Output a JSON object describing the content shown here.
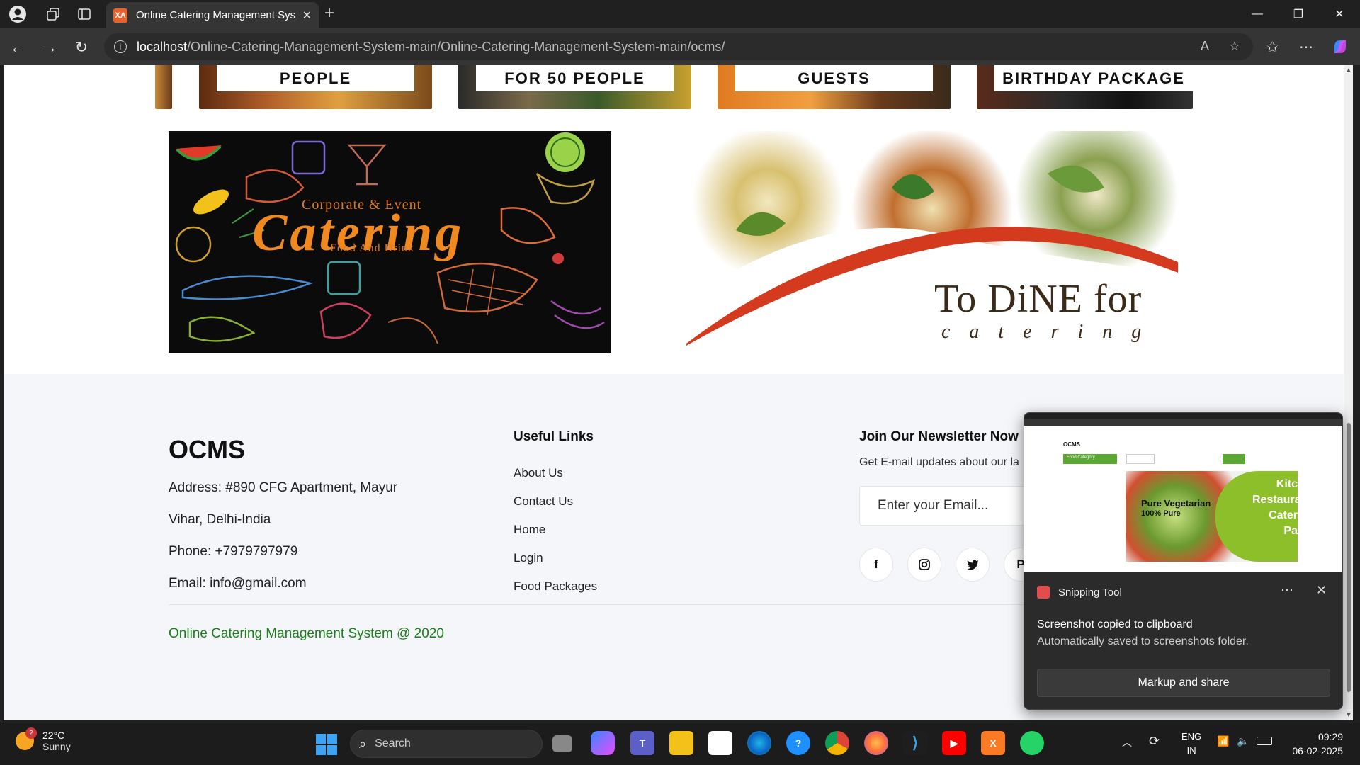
{
  "browser": {
    "tab_title": "Online Catering Management Sys",
    "tab_favicon": "XA",
    "url_host": "localhost",
    "url_path": "/Online-Catering-Management-System-main/Online-Catering-Management-System-main/ocms/"
  },
  "packages": [
    {
      "label": "PEOPLE"
    },
    {
      "label": "FOR 50 PEOPLE"
    },
    {
      "label": "GUESTS"
    },
    {
      "label": "BIRTHDAY PACKAGE"
    }
  ],
  "banner1": {
    "line1": "Corporate & Event",
    "line2": "Catering",
    "line3": "Food And Drink"
  },
  "banner2": {
    "line1": "To DiNE for",
    "line2": "c a t e r i n g"
  },
  "footer": {
    "brand": "OCMS",
    "address_line1": "Address: #890 CFG Apartment, Mayur",
    "address_line2": "Vihar, Delhi-India",
    "phone": "Phone: +7979797979",
    "email": "Email: info@gmail.com",
    "links_heading": "Useful Links",
    "links": [
      "About Us",
      "Contact Us",
      "Home",
      "Login",
      "Food Packages"
    ],
    "newsletter_heading": "Join Our Newsletter Now",
    "newsletter_desc": "Get E-mail updates about our la",
    "email_placeholder": "Enter your Email...",
    "copyright": "Online Catering Management System @ 2020"
  },
  "toast": {
    "app_name": "Snipping Tool",
    "message": "Screenshot copied to clipboard",
    "sub_message": "Automatically saved to screenshots folder.",
    "button": "Markup and share",
    "preview": {
      "brand": "OCMS",
      "category": "Food Category",
      "pure_veg": "Pure Vegetarian",
      "pure": "100% Pure",
      "side_text": "Kitc Restaura Cater Pa"
    }
  },
  "taskbar": {
    "weather_temp": "22°C",
    "weather_desc": "Sunny",
    "weather_badge": "2",
    "search_label": "Search",
    "lang1": "ENG",
    "lang2": "IN",
    "time": "09:29",
    "date": "06-02-2025"
  }
}
